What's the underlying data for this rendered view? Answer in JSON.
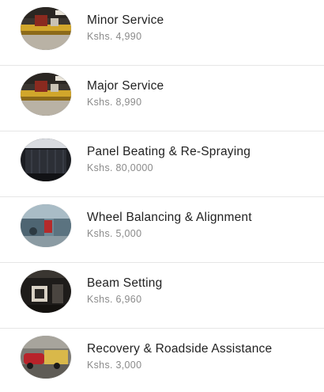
{
  "services": [
    {
      "title": "Minor Service",
      "price": "Kshs. 4,990",
      "image_icon": "workshop-lift-photo"
    },
    {
      "title": "Major Service",
      "price": "Kshs. 8,990",
      "image_icon": "workshop-lift-photo"
    },
    {
      "title": "Panel Beating & Re-Spraying",
      "price": "Kshs. 80,0000",
      "image_icon": "spray-booth-photo"
    },
    {
      "title": "Wheel Balancing & Alignment",
      "price": "Kshs. 5,000",
      "image_icon": "wheel-alignment-photo"
    },
    {
      "title": "Beam Setting",
      "price": "Kshs. 6,960",
      "image_icon": "headlamp-beam-photo"
    },
    {
      "title": "Recovery & Roadside Assistance",
      "price": "Kshs. 3,000",
      "image_icon": "tow-truck-photo"
    }
  ]
}
